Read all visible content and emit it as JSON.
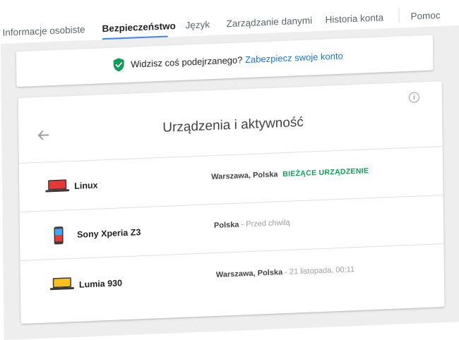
{
  "nav": {
    "tabs": [
      {
        "label": "Informacje osobiste",
        "active": false
      },
      {
        "label": "Bezpieczeństwo",
        "active": true
      },
      {
        "label": "Język",
        "active": false
      },
      {
        "label": "Zarządzanie danymi",
        "active": false
      },
      {
        "label": "Historia konta",
        "active": false
      },
      {
        "label": "Pomoc",
        "active": false
      }
    ]
  },
  "alert": {
    "icon": "shield-check-icon",
    "text": "Widzisz coś podejrzanego?",
    "link": "Zabezpiecz swoje konto"
  },
  "devices_card": {
    "title": "Urządzenia i aktywność",
    "back_icon": "arrow-back-icon",
    "info_icon": "info-icon",
    "devices": [
      {
        "name": "Linux",
        "icon": "laptop-icon",
        "location": "Warszawa, Polska",
        "time": "",
        "current": "BIEŻĄCE URZĄDZENIE"
      },
      {
        "name": "Sony Xperia Z3",
        "icon": "phone-icon",
        "location": "Polska",
        "time": " - Przed chwilą",
        "current": ""
      },
      {
        "name": "Lumia 930",
        "icon": "laptop-icon",
        "location": "Warszawa, Polska",
        "time": " - 21 listopada, 00:11",
        "current": ""
      }
    ]
  },
  "colors": {
    "accent": "#4285f4",
    "link": "#1a73e8",
    "current_device": "#0f9d58",
    "shield": "#0f9d58",
    "laptop_linux": "#e53935",
    "laptop_lumia": "#f9c21b"
  }
}
